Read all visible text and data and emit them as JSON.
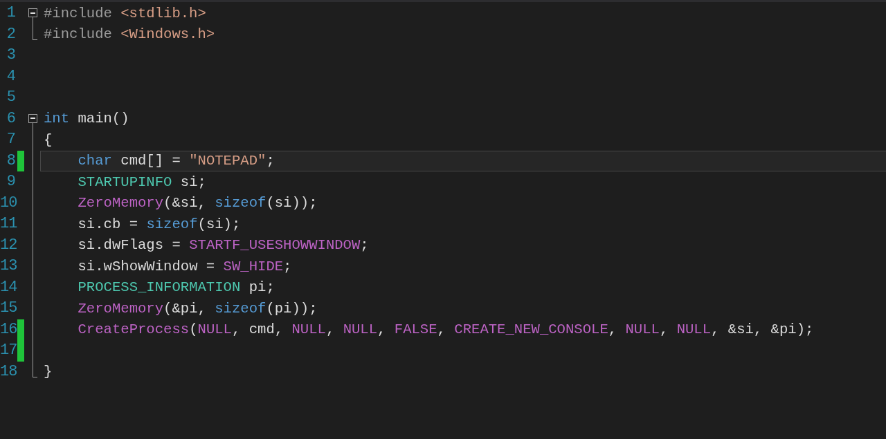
{
  "editor": {
    "lines": [
      {
        "number": "1",
        "changed": false,
        "current": false,
        "kind": "foldstart",
        "indented": false,
        "tokens": [
          {
            "kind": "preprocessor",
            "text": "#include"
          },
          {
            "kind": "header",
            "text": " <stdlib.h>"
          }
        ]
      },
      {
        "number": "2",
        "changed": false,
        "current": false,
        "kind": "foldend",
        "indented": false,
        "tokens": [
          {
            "kind": "preprocessor",
            "text": "#include"
          },
          {
            "kind": "header",
            "text": " <Windows.h>"
          }
        ]
      },
      {
        "number": "3",
        "changed": false,
        "current": false,
        "kind": "plain"
      },
      {
        "number": "4",
        "changed": false,
        "current": false,
        "kind": "plain"
      },
      {
        "number": "5",
        "changed": false,
        "current": false,
        "kind": "plain"
      },
      {
        "number": "6",
        "changed": false,
        "current": false,
        "kind": "foldstart",
        "indented": false,
        "tokens": [
          {
            "kind": "keyword",
            "text": "int"
          },
          {
            "kind": "plain",
            "text": " main()"
          }
        ]
      },
      {
        "number": "7",
        "changed": false,
        "current": false,
        "kind": "foldbody",
        "indented": false,
        "tokens": [
          {
            "kind": "plain",
            "text": "{"
          }
        ]
      },
      {
        "number": "8",
        "changed": true,
        "current": true,
        "kind": "foldbody",
        "indented": true,
        "tokens": [
          {
            "kind": "keyword",
            "text": "char"
          },
          {
            "kind": "plain",
            "text": " cmd[] = "
          },
          {
            "kind": "string",
            "text": "\"NOTEPAD\""
          },
          {
            "kind": "plain",
            "text": ";"
          }
        ]
      },
      {
        "number": "9",
        "changed": false,
        "current": false,
        "kind": "foldbody",
        "indented": true,
        "tokens": [
          {
            "kind": "type",
            "text": "STARTUPINFO"
          },
          {
            "kind": "plain",
            "text": " si;"
          }
        ]
      },
      {
        "number": "10",
        "changed": false,
        "current": false,
        "kind": "foldbody",
        "indented": true,
        "tokens": [
          {
            "kind": "macro",
            "text": "ZeroMemory"
          },
          {
            "kind": "plain",
            "text": "(&si, "
          },
          {
            "kind": "keyword",
            "text": "sizeof"
          },
          {
            "kind": "plain",
            "text": "(si));"
          }
        ]
      },
      {
        "number": "11",
        "changed": false,
        "current": false,
        "kind": "foldbody",
        "indented": true,
        "tokens": [
          {
            "kind": "plain",
            "text": "si.cb = "
          },
          {
            "kind": "keyword",
            "text": "sizeof"
          },
          {
            "kind": "plain",
            "text": "(si);"
          }
        ]
      },
      {
        "number": "12",
        "changed": false,
        "current": false,
        "kind": "foldbody",
        "indented": true,
        "tokens": [
          {
            "kind": "plain",
            "text": "si.dwFlags = "
          },
          {
            "kind": "macro",
            "text": "STARTF_USESHOWWINDOW"
          },
          {
            "kind": "plain",
            "text": ";"
          }
        ]
      },
      {
        "number": "13",
        "changed": false,
        "current": false,
        "kind": "foldbody",
        "indented": true,
        "tokens": [
          {
            "kind": "plain",
            "text": "si.wShowWindow = "
          },
          {
            "kind": "macro",
            "text": "SW_HIDE"
          },
          {
            "kind": "plain",
            "text": ";"
          }
        ]
      },
      {
        "number": "14",
        "changed": false,
        "current": false,
        "kind": "foldbody",
        "indented": true,
        "tokens": [
          {
            "kind": "type",
            "text": "PROCESS_INFORMATION"
          },
          {
            "kind": "plain",
            "text": " pi;"
          }
        ]
      },
      {
        "number": "15",
        "changed": false,
        "current": false,
        "kind": "foldbody",
        "indented": true,
        "tokens": [
          {
            "kind": "macro",
            "text": "ZeroMemory"
          },
          {
            "kind": "plain",
            "text": "(&pi, "
          },
          {
            "kind": "keyword",
            "text": "sizeof"
          },
          {
            "kind": "plain",
            "text": "(pi));"
          }
        ]
      },
      {
        "number": "16",
        "changed": true,
        "current": false,
        "kind": "foldbody",
        "indented": true,
        "tokens": [
          {
            "kind": "macro",
            "text": "CreateProcess"
          },
          {
            "kind": "plain",
            "text": "("
          },
          {
            "kind": "macro",
            "text": "NULL"
          },
          {
            "kind": "plain",
            "text": ", cmd, "
          },
          {
            "kind": "macro",
            "text": "NULL"
          },
          {
            "kind": "plain",
            "text": ", "
          },
          {
            "kind": "macro",
            "text": "NULL"
          },
          {
            "kind": "plain",
            "text": ", "
          },
          {
            "kind": "macro",
            "text": "FALSE"
          },
          {
            "kind": "plain",
            "text": ", "
          },
          {
            "kind": "macro",
            "text": "CREATE_NEW_CONSOLE"
          },
          {
            "kind": "plain",
            "text": ", "
          },
          {
            "kind": "macro",
            "text": "NULL"
          },
          {
            "kind": "plain",
            "text": ", "
          },
          {
            "kind": "macro",
            "text": "NULL"
          },
          {
            "kind": "plain",
            "text": ", &si, &pi);"
          }
        ]
      },
      {
        "number": "17",
        "changed": true,
        "current": false,
        "kind": "foldbody"
      },
      {
        "number": "18",
        "changed": false,
        "current": false,
        "kind": "foldend",
        "indented": false,
        "tokens": [
          {
            "kind": "plain",
            "text": "}"
          }
        ]
      }
    ]
  }
}
